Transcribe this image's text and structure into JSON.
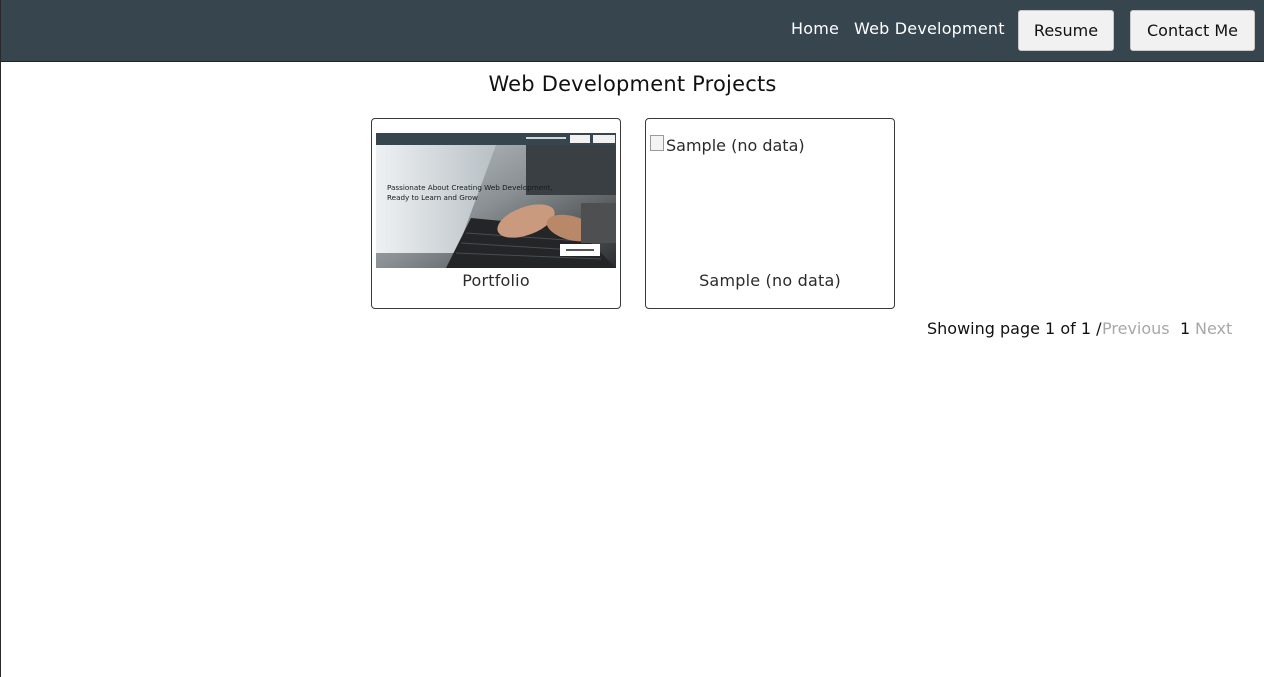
{
  "nav": {
    "links": [
      {
        "label": "Home"
      },
      {
        "label": "Web Development"
      }
    ],
    "resume_label": "Resume",
    "contact_label": "Contact Me"
  },
  "main": {
    "title": "Web Development Projects",
    "projects": [
      {
        "label": "Portfolio",
        "thumbnail": {
          "headline_line1": "Passionate About Creating Web Development,",
          "headline_line2": "Ready to Learn and Grow"
        }
      },
      {
        "label": "Sample (no data)",
        "image_alt": "Sample (no data)"
      }
    ]
  },
  "pagination": {
    "status": "Showing page 1 of 1 /",
    "previous_label": "Previous",
    "current_page": "1",
    "next_label": "Next"
  },
  "colors": {
    "navbar_bg": "#37454f",
    "disabled_text": "#a8a8a8"
  }
}
